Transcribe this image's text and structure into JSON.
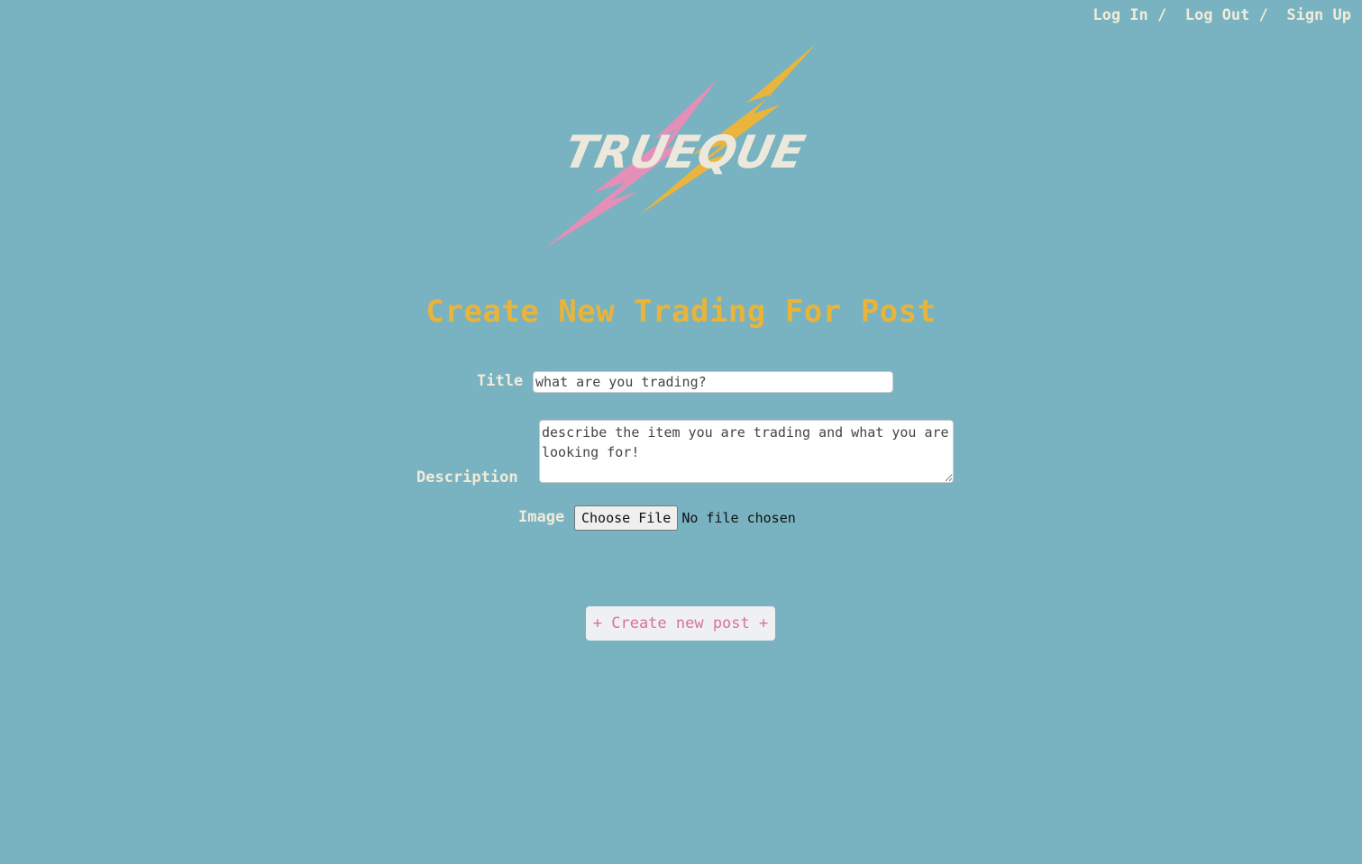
{
  "nav": {
    "login_label": "Log In",
    "logout_label": "Log Out",
    "signup_label": "Sign Up",
    "separator": " /  "
  },
  "logo": {
    "text": "TRUEQUE",
    "colors": {
      "pink_bolt": "#e48fb8",
      "yellow_bolt": "#e9b53c",
      "text": "#ece8dc"
    }
  },
  "page_title": "Create New Trading For Post",
  "form": {
    "title_label": "Title",
    "title_placeholder": "what are you trading?",
    "description_label": "Description",
    "description_placeholder": "describe the item you are trading and what you are looking for!",
    "image_label": "Image",
    "file_button_label": "Choose File",
    "file_status": "No file chosen",
    "submit_label": "+ Create new post +"
  },
  "colors": {
    "background": "#79b2c0",
    "title": "#e8b43a",
    "label": "#f1ecd9",
    "submit_text": "#d9739a"
  }
}
